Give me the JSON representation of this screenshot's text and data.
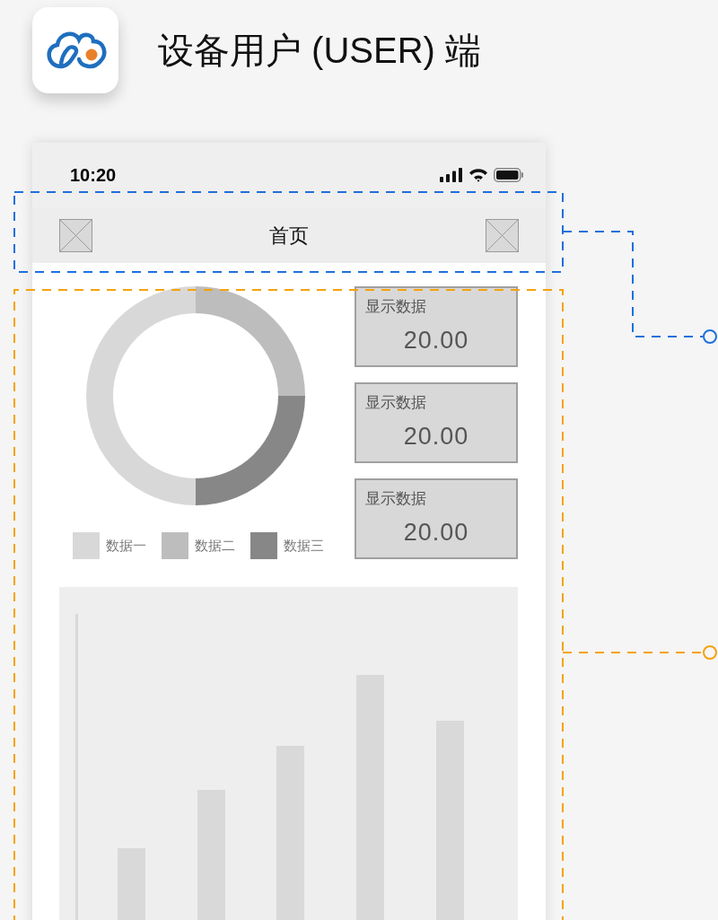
{
  "header": {
    "title": "设备用户 (USER) 端"
  },
  "phone": {
    "status_bar": {
      "time": "10:20"
    },
    "nav_bar": {
      "title": "首页"
    },
    "legend": [
      {
        "label": "数据一",
        "color": "#d8d8d8"
      },
      {
        "label": "数据二",
        "color": "#bdbdbd"
      },
      {
        "label": "数据三",
        "color": "#878787"
      }
    ],
    "stat_cards": [
      {
        "label": "显示数据",
        "value": "20.00"
      },
      {
        "label": "显示数据",
        "value": "20.00"
      },
      {
        "label": "显示数据",
        "value": "20.00"
      }
    ]
  }
}
